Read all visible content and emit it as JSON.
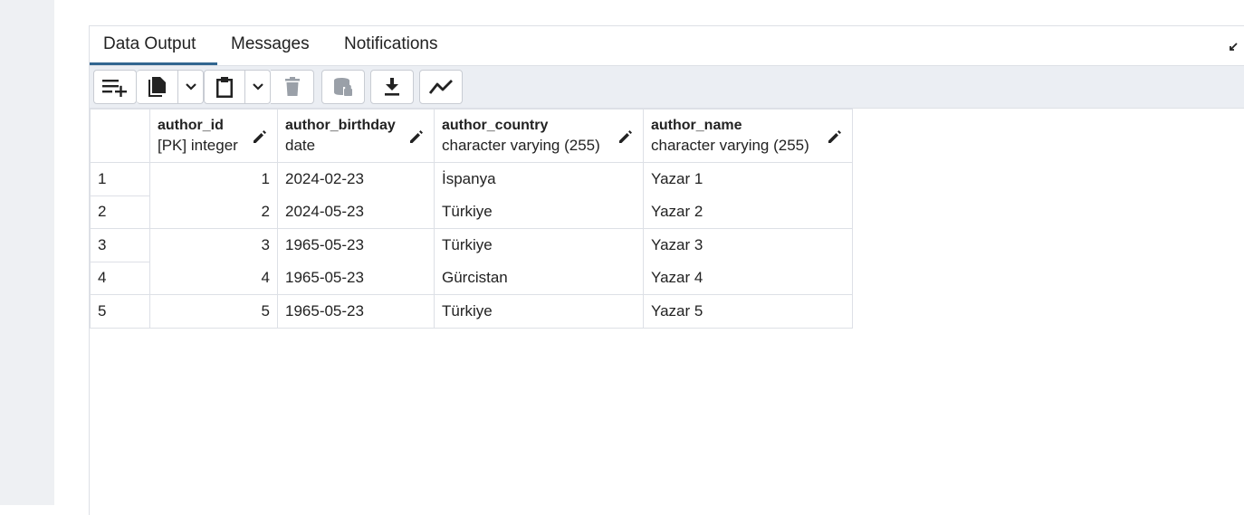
{
  "tabs": [
    {
      "label": "Data Output",
      "active": true
    },
    {
      "label": "Messages",
      "active": false
    },
    {
      "label": "Notifications",
      "active": false
    }
  ],
  "toolbar": {
    "icons": [
      "add-row-icon",
      "copy-icon",
      "chevron-down-icon",
      "paste-icon",
      "chevron-down-icon",
      "delete-icon",
      "save-data-icon",
      "download-icon",
      "graph-icon"
    ]
  },
  "colors": {
    "active_tab": "#326690",
    "toolbar_bg": "#ebeef3",
    "border": "#dde0e6"
  },
  "grid": {
    "columns": [
      {
        "name": "author_id",
        "type": "[PK] integer"
      },
      {
        "name": "author_birthday",
        "type": "date"
      },
      {
        "name": "author_country",
        "type": "character varying (255)"
      },
      {
        "name": "author_name",
        "type": "character varying (255)"
      }
    ],
    "rows": [
      {
        "num": "1",
        "author_id": "1",
        "author_birthday": "2024-02-23",
        "author_country": "İspanya",
        "author_name": "Yazar 1"
      },
      {
        "num": "2",
        "author_id": "2",
        "author_birthday": "2024-05-23",
        "author_country": "Türkiye",
        "author_name": "Yazar 2"
      },
      {
        "num": "3",
        "author_id": "3",
        "author_birthday": "1965-05-23",
        "author_country": "Türkiye",
        "author_name": "Yazar 3"
      },
      {
        "num": "4",
        "author_id": "4",
        "author_birthday": "1965-05-23",
        "author_country": "Gürcistan",
        "author_name": "Yazar 4"
      },
      {
        "num": "5",
        "author_id": "5",
        "author_birthday": "1965-05-23",
        "author_country": "Türkiye",
        "author_name": "Yazar 5"
      }
    ]
  }
}
